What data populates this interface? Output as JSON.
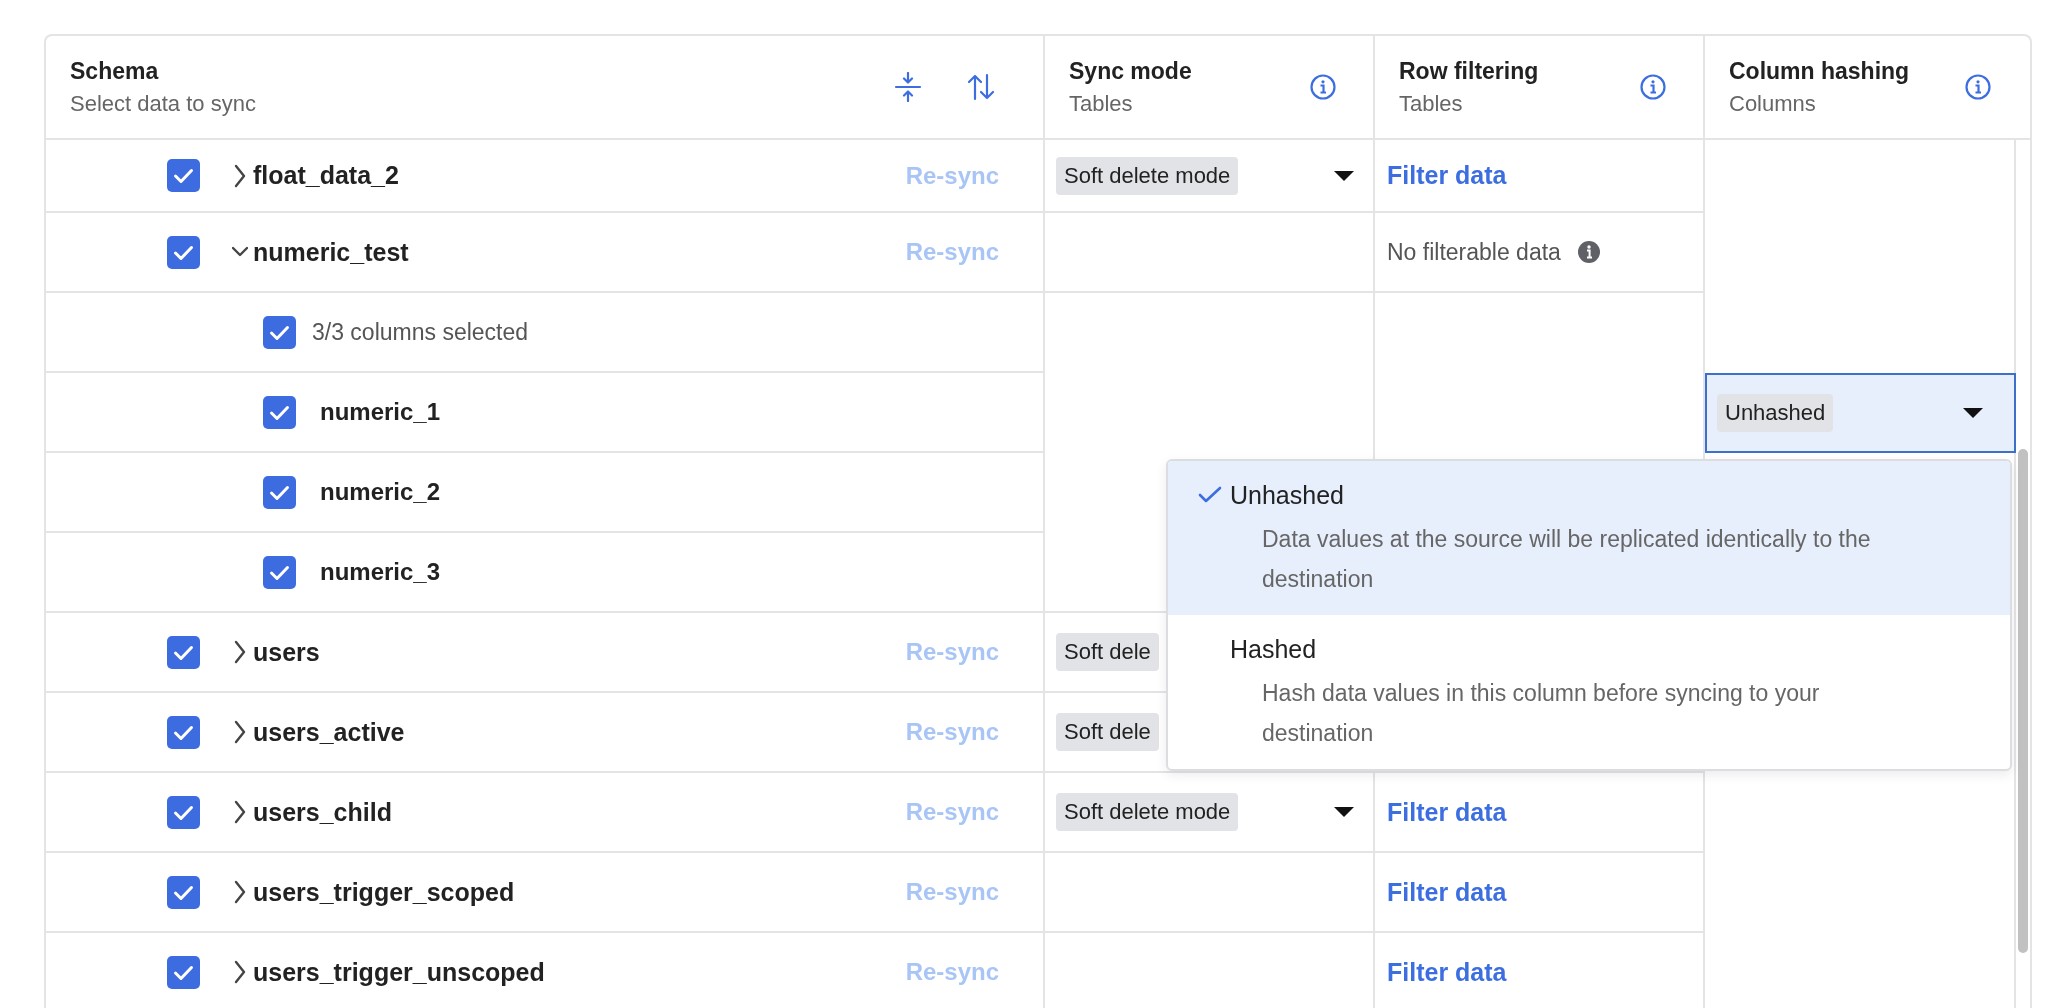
{
  "columns": [
    {
      "kind": "schema",
      "title": "Schema",
      "subtitle": "Select data to sync"
    },
    {
      "kind": "info",
      "title": "Sync mode",
      "subtitle": "Tables"
    },
    {
      "kind": "info",
      "title": "Row filtering",
      "subtitle": "Tables"
    },
    {
      "kind": "info",
      "title": "Column hashing",
      "subtitle": "Columns"
    }
  ],
  "rows": [
    {
      "kind": "table",
      "name": "float_data_2",
      "checked": true,
      "expanded": false,
      "action": "Re-sync",
      "sync": {
        "label": "Soft delete mode",
        "caret": true
      },
      "filter": {
        "kind": "link",
        "label": "Filter data"
      }
    },
    {
      "kind": "table",
      "name": "numeric_test",
      "checked": true,
      "expanded": true,
      "action": "Re-sync",
      "filter": {
        "kind": "note",
        "label": "No filterable data"
      },
      "children": [
        {
          "kind": "summary",
          "label": "3/3 columns selected",
          "checked": true
        },
        {
          "kind": "column",
          "name": "numeric_1",
          "checked": true,
          "hashing": {
            "value": "Unhashed",
            "open": true,
            "options": [
              {
                "title": "Unhashed",
                "description": "Data values at the source will be replicated identically to the destination",
                "selected": true
              },
              {
                "title": "Hashed",
                "description": "Hash data values in this column before syncing to your destination",
                "selected": false
              }
            ]
          }
        },
        {
          "kind": "column",
          "name": "numeric_2",
          "checked": true
        },
        {
          "kind": "column",
          "name": "numeric_3",
          "checked": true
        }
      ]
    },
    {
      "kind": "table",
      "name": "users",
      "checked": true,
      "expanded": false,
      "action": "Re-sync",
      "sync": {
        "label": "Soft dele",
        "caret": false
      }
    },
    {
      "kind": "table",
      "name": "users_active",
      "checked": true,
      "expanded": false,
      "action": "Re-sync",
      "sync": {
        "label": "Soft dele",
        "caret": false
      }
    },
    {
      "kind": "table",
      "name": "users_child",
      "checked": true,
      "expanded": false,
      "action": "Re-sync",
      "sync": {
        "label": "Soft delete mode",
        "caret": true
      },
      "filter": {
        "kind": "link",
        "label": "Filter data"
      }
    },
    {
      "kind": "table",
      "name": "users_trigger_scoped",
      "checked": true,
      "expanded": false,
      "action": "Re-sync",
      "filter": {
        "kind": "link",
        "label": "Filter data"
      }
    },
    {
      "kind": "table",
      "name": "users_trigger_unscoped",
      "checked": true,
      "expanded": false,
      "action": "Re-sync",
      "filter": {
        "kind": "link",
        "label": "Filter data"
      }
    }
  ]
}
